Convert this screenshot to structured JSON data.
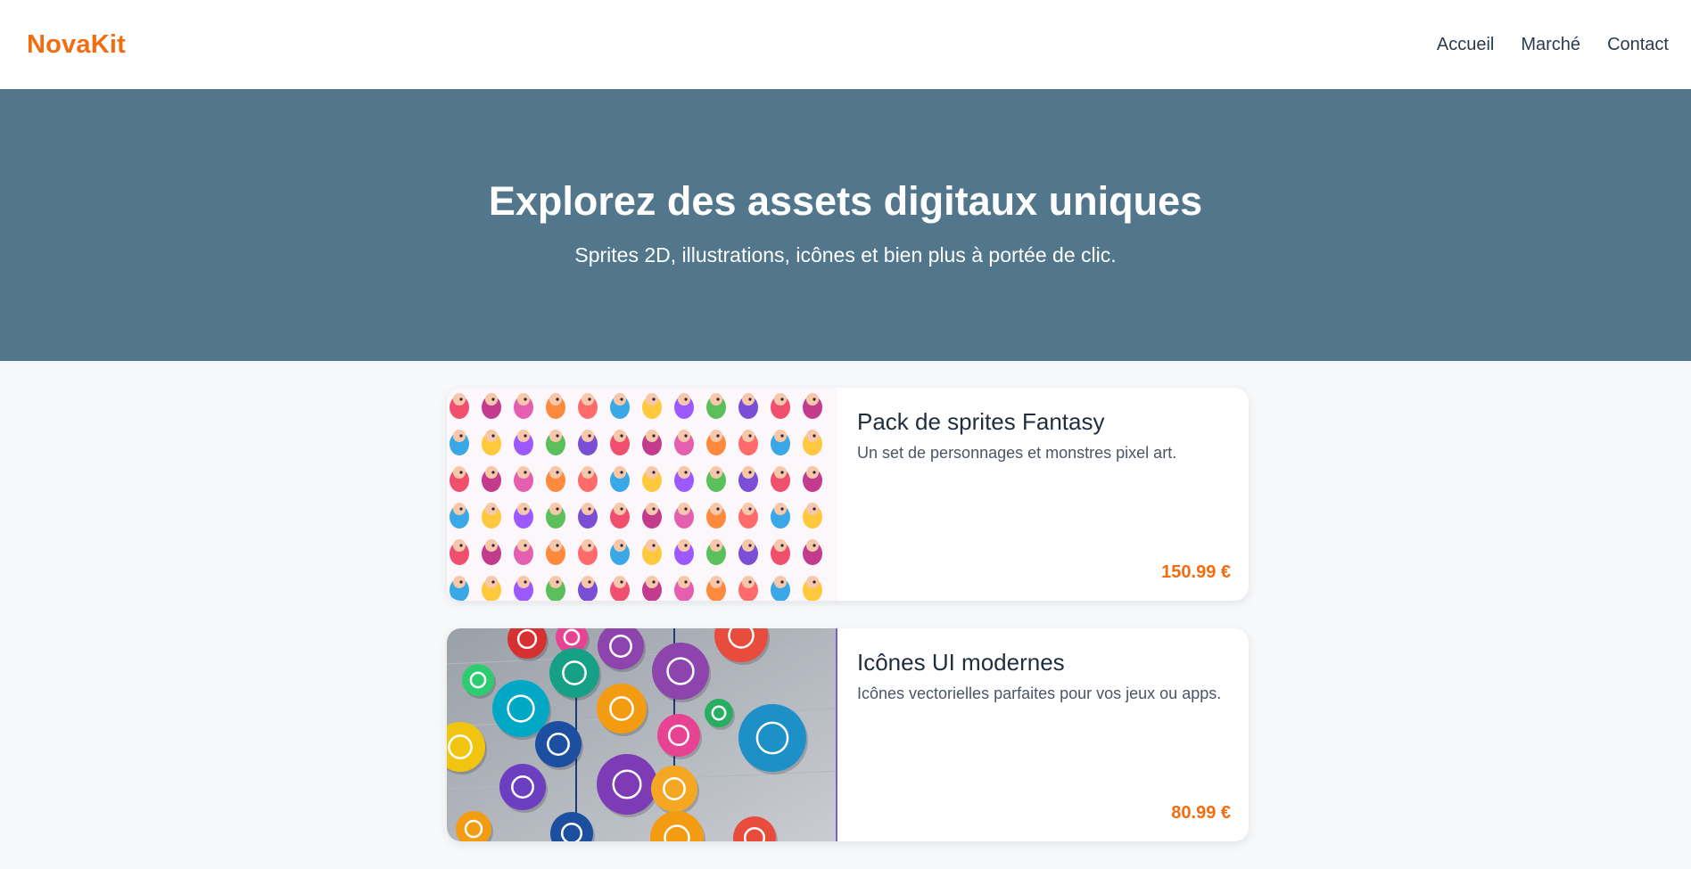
{
  "header": {
    "brand": "NovaKit",
    "nav": [
      "Accueil",
      "Marché",
      "Contact"
    ]
  },
  "hero": {
    "title": "Explorez des assets digitaux uniques",
    "subtitle": "Sprites 2D, illustrations, icônes et bien plus à portée de clic."
  },
  "products": [
    {
      "title": "Pack de sprites Fantasy",
      "description": "Un set de personnages et monstres pixel art.",
      "price": "150.99 €",
      "image": "sprite-sheet-image"
    },
    {
      "title": "Icônes UI modernes",
      "description": "Icônes vectorielles parfaites pour vos jeux ou apps.",
      "price": "80.99 €",
      "image": "ui-icons-image"
    }
  ],
  "colors": {
    "accent": "#f26c10",
    "hero_bg": "#52768c",
    "page_bg": "#f7f8fa"
  }
}
